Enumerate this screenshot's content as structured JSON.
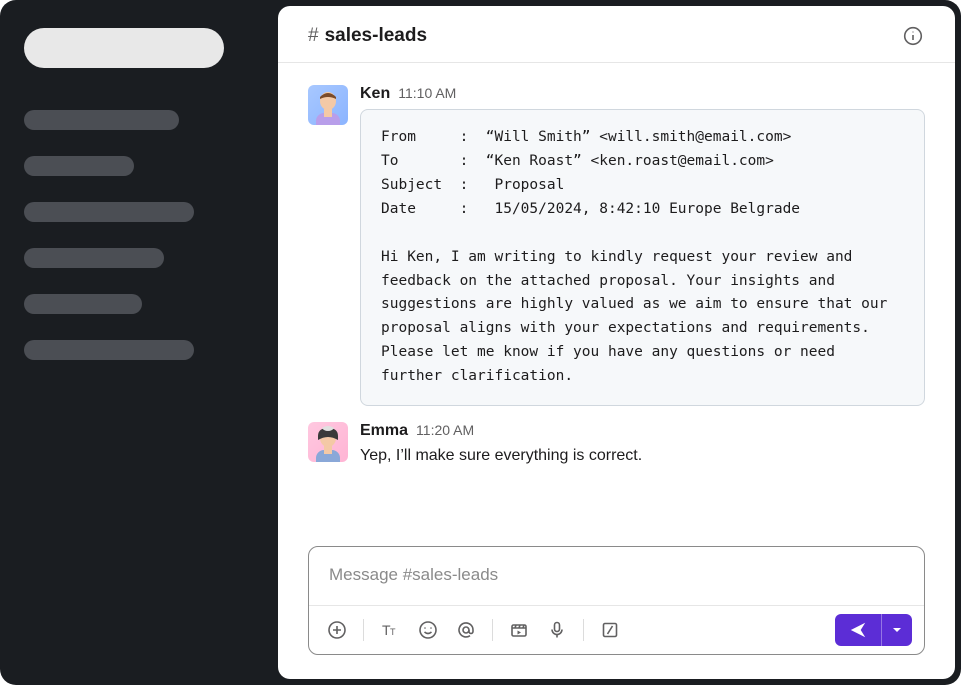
{
  "channel": {
    "hash": "#",
    "name": "sales-leads"
  },
  "messages": [
    {
      "sender": "Ken",
      "time": "11:10 AM",
      "email": "From     :  “Will Smith” <will.smith@email.com>\nTo       :  “Ken Roast” <ken.roast@email.com>\nSubject  :   Proposal\nDate     :   15/05/2024, 8:42:10 Europe Belgrade\n\nHi Ken, I am writing to kindly request your review and feedback on the attached proposal. Your insights and suggestions are highly valued as we aim to ensure that our proposal aligns with your expectations and requirements. Please let me know if you have any questions or need further clarification."
    },
    {
      "sender": "Emma",
      "time": "11:20 AM",
      "text": "Yep, I’ll make sure everything is correct."
    }
  ],
  "composer": {
    "placeholder": "Message #sales-leads"
  }
}
